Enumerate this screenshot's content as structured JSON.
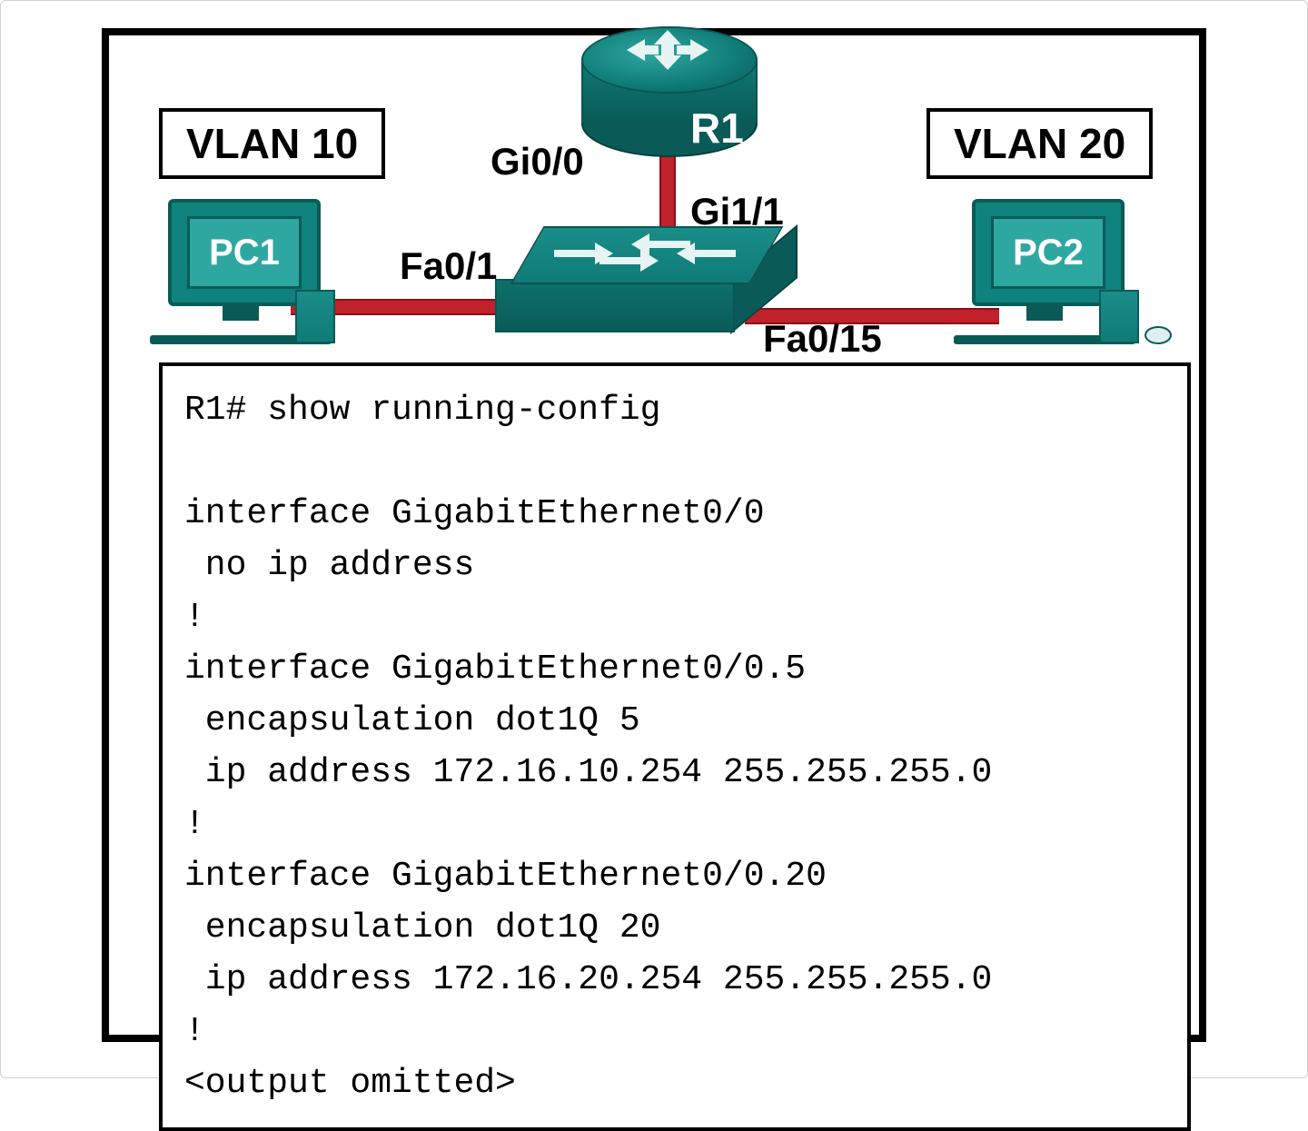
{
  "diagram": {
    "vlan10_label": "VLAN 10",
    "vlan20_label": "VLAN 20",
    "router_name": "R1",
    "pc1_name": "PC1",
    "pc2_name": "PC2",
    "if_router": "Gi0/0",
    "if_switch_uplink": "Gi1/1",
    "if_switch_pc1": "Fa0/1",
    "if_switch_pc2": "Fa0/15"
  },
  "cli": {
    "prompt": "R1# show running-config",
    "config_text": "interface GigabitEthernet0/0\n no ip address\n!\ninterface GigabitEthernet0/0.5\n encapsulation dot1Q 5\n ip address 172.16.10.254 255.255.255.0\n!\ninterface GigabitEthernet0/0.20\n encapsulation dot1Q 20\n ip address 172.16.20.254 255.255.255.0\n!\n<output omitted>"
  },
  "config_structured": {
    "interfaces": [
      {
        "name": "GigabitEthernet0/0",
        "ip": null,
        "mask": null,
        "dot1q": null,
        "note": "no ip address"
      },
      {
        "name": "GigabitEthernet0/0.5",
        "ip": "172.16.10.254",
        "mask": "255.255.255.0",
        "dot1q": 5
      },
      {
        "name": "GigabitEthernet0/0.20",
        "ip": "172.16.20.254",
        "mask": "255.255.255.0",
        "dot1q": 20
      }
    ]
  }
}
